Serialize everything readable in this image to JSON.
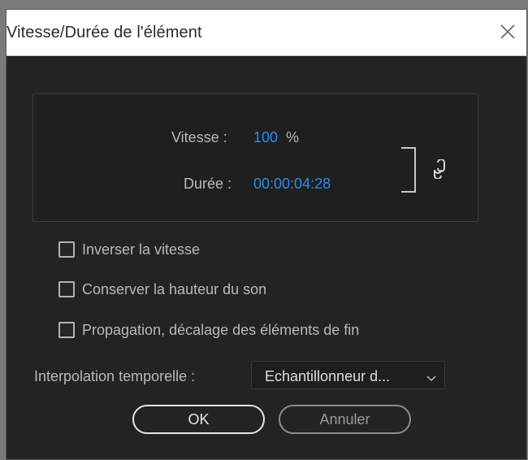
{
  "window": {
    "title": "Vitesse/Durée de l'élément"
  },
  "speed": {
    "label": "Vitesse :",
    "value": "100",
    "unit": "%"
  },
  "duration": {
    "label": "Durée :",
    "value": "00:00:04:28"
  },
  "options": [
    {
      "label": "Inverser la vitesse",
      "checked": false
    },
    {
      "label": "Conserver la hauteur du son",
      "checked": false
    },
    {
      "label": "Propagation, décalage des éléments de fin",
      "checked": false
    }
  ],
  "interpolation": {
    "label": "Interpolation temporelle :",
    "selected": "Echantillonneur d..."
  },
  "buttons": {
    "ok": "OK",
    "cancel": "Annuler"
  },
  "colors": {
    "accent": "#2d8ceb",
    "background": "#232323",
    "titlebar": "#ffffff"
  },
  "icons": {
    "close": "close-icon",
    "link": "link-icon",
    "chevron": "chevron-down-icon"
  }
}
